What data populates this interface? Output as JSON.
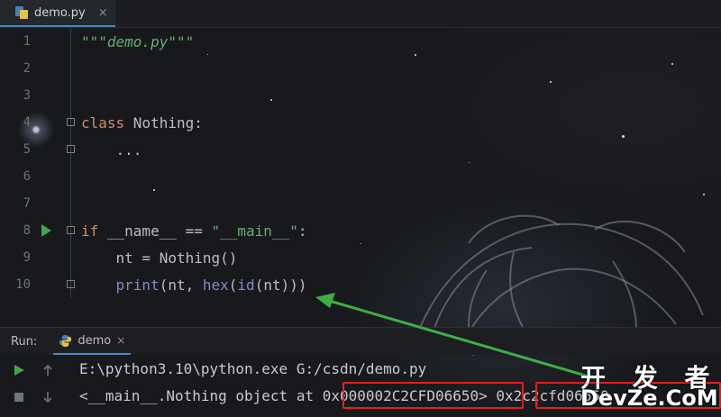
{
  "editor_tab": {
    "filename": "demo.py",
    "close": "×"
  },
  "code_lines": [
    {
      "num": "1",
      "text": "\"\"\"demo.py\"\"\""
    },
    {
      "num": "2",
      "text": ""
    },
    {
      "num": "3",
      "text": ""
    },
    {
      "num": "4",
      "text": "class Nothing:"
    },
    {
      "num": "5",
      "text": "    ..."
    },
    {
      "num": "6",
      "text": ""
    },
    {
      "num": "7",
      "text": ""
    },
    {
      "num": "8",
      "text": "if __name__ == \"__main__\":"
    },
    {
      "num": "9",
      "text": "    nt = Nothing()"
    },
    {
      "num": "10",
      "text": "    print(nt, hex(id(nt)))"
    }
  ],
  "run_panel": {
    "label": "Run:",
    "tab_name": "demo",
    "close": "×",
    "output_line1": "E:\\python3.10\\python.exe G:/csdn/demo.py",
    "output_line2_prefix": "<__main__.Nothing object at ",
    "output_address": "0x000002C2CFD06650",
    "output_line2_suffix": "> ",
    "output_hex": "0x2c2cfd06650"
  },
  "watermark": {
    "cn": "开 发 者",
    "en": "DevZe.CoM"
  },
  "colors": {
    "accent": "#4a88c7",
    "run_green": "#46a24b",
    "highlight_red": "#e02020",
    "arrow_green": "#3cb043"
  }
}
